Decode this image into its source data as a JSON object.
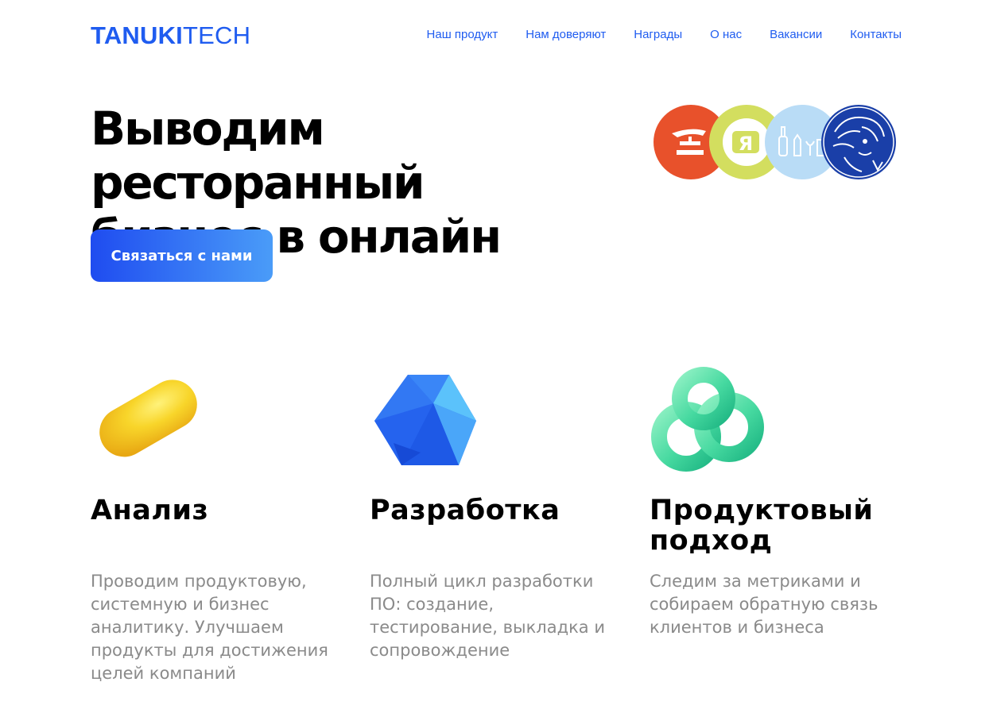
{
  "brand": {
    "logo_bold": "TANUKI",
    "logo_light": "TECH",
    "accent_color": "#1f5cf0"
  },
  "nav": {
    "items": [
      {
        "label": "Наш продукт"
      },
      {
        "label": "Нам доверяют"
      },
      {
        "label": "Награды"
      },
      {
        "label": "О нас"
      },
      {
        "label": "Вакансии"
      },
      {
        "label": "Контакты"
      }
    ]
  },
  "hero": {
    "title_line1": "Выводим ресторанный",
    "title_line2": "бизнес в онлайн",
    "cta_label": "Связаться с нами",
    "client_badge_letter": "Я",
    "client_badge_colors": [
      "#e8512b",
      "#d3de5f",
      "#b9dcf6",
      "#1a3fa8"
    ]
  },
  "features": [
    {
      "icon": "capsule-icon",
      "title": "Анализ",
      "text": "Проводим продуктовую, системную и бизнес аналитику. Улучшаем продукты для достижения целей компаний"
    },
    {
      "icon": "icosahedron-icon",
      "title": "Разработка",
      "text": "Полный цикл разработки ПО: создание, тестирование, выкладка и сопровождение"
    },
    {
      "icon": "knot-icon",
      "title": "Продуктовый подход",
      "text": "Следим за метриками и собираем обратную связь клиентов и бизнеса"
    }
  ]
}
